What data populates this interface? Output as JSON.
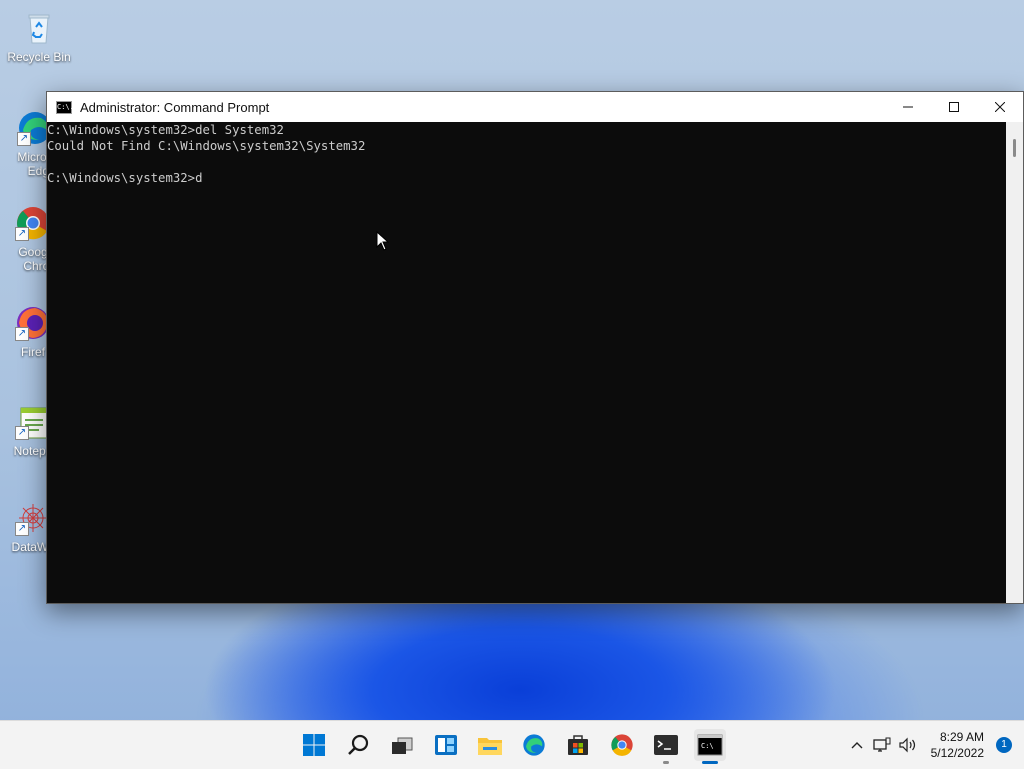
{
  "desktop": {
    "icons": [
      {
        "label": "Recycle Bin",
        "icon": "recycle-bin-icon"
      },
      {
        "label": "Micros\nEdg",
        "icon": "edge-icon"
      },
      {
        "label": "Goog\nChro",
        "icon": "chrome-icon"
      },
      {
        "label": "Firef",
        "icon": "firefox-icon"
      },
      {
        "label": "Notepa",
        "icon": "notepad-icon"
      },
      {
        "label": "DataWa",
        "icon": "datawave-icon"
      }
    ]
  },
  "window": {
    "title": "Administrator: Command Prompt",
    "icon_text": "C:\\.",
    "console_lines": [
      "C:\\Windows\\system32>del System32",
      "Could Not Find C:\\Windows\\system32\\System32",
      "",
      "C:\\Windows\\system32>d"
    ]
  },
  "taskbar": {
    "apps": [
      "start",
      "search",
      "task-view",
      "widgets",
      "file-explorer",
      "edge",
      "store",
      "chrome",
      "terminal",
      "command-prompt"
    ],
    "clock_time": "8:29 AM",
    "clock_date": "5/12/2022",
    "notification_count": "1"
  },
  "colors": {
    "console_bg": "#0c0c0c",
    "console_text": "#cccccc",
    "accent": "#0067c0"
  }
}
